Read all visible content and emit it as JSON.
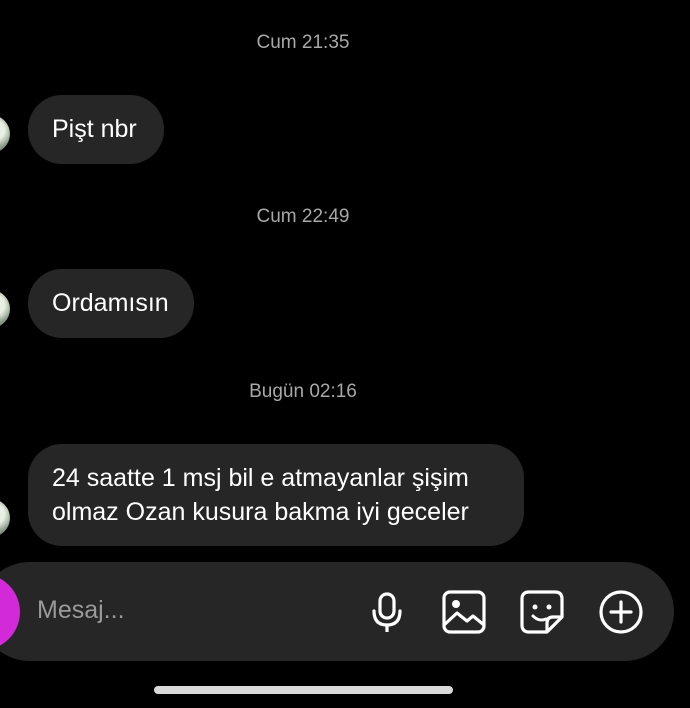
{
  "messages": [
    {
      "timestamp": "Cum 21:35",
      "text": "Pişt nbr"
    },
    {
      "timestamp": "Cum 22:49",
      "text": "Ordamısın"
    },
    {
      "timestamp": "Bugün 02:16",
      "text": "24 saatte 1 msj bil e atmayanlar şişim\nolmaz Ozan kusura bakma iyi geceler"
    }
  ],
  "composer": {
    "placeholder": "Mesaj...",
    "icons": [
      "camera-icon",
      "microphone-icon",
      "gallery-icon",
      "sticker-icon",
      "plus-icon"
    ],
    "accent_color": "#d12ad6"
  }
}
